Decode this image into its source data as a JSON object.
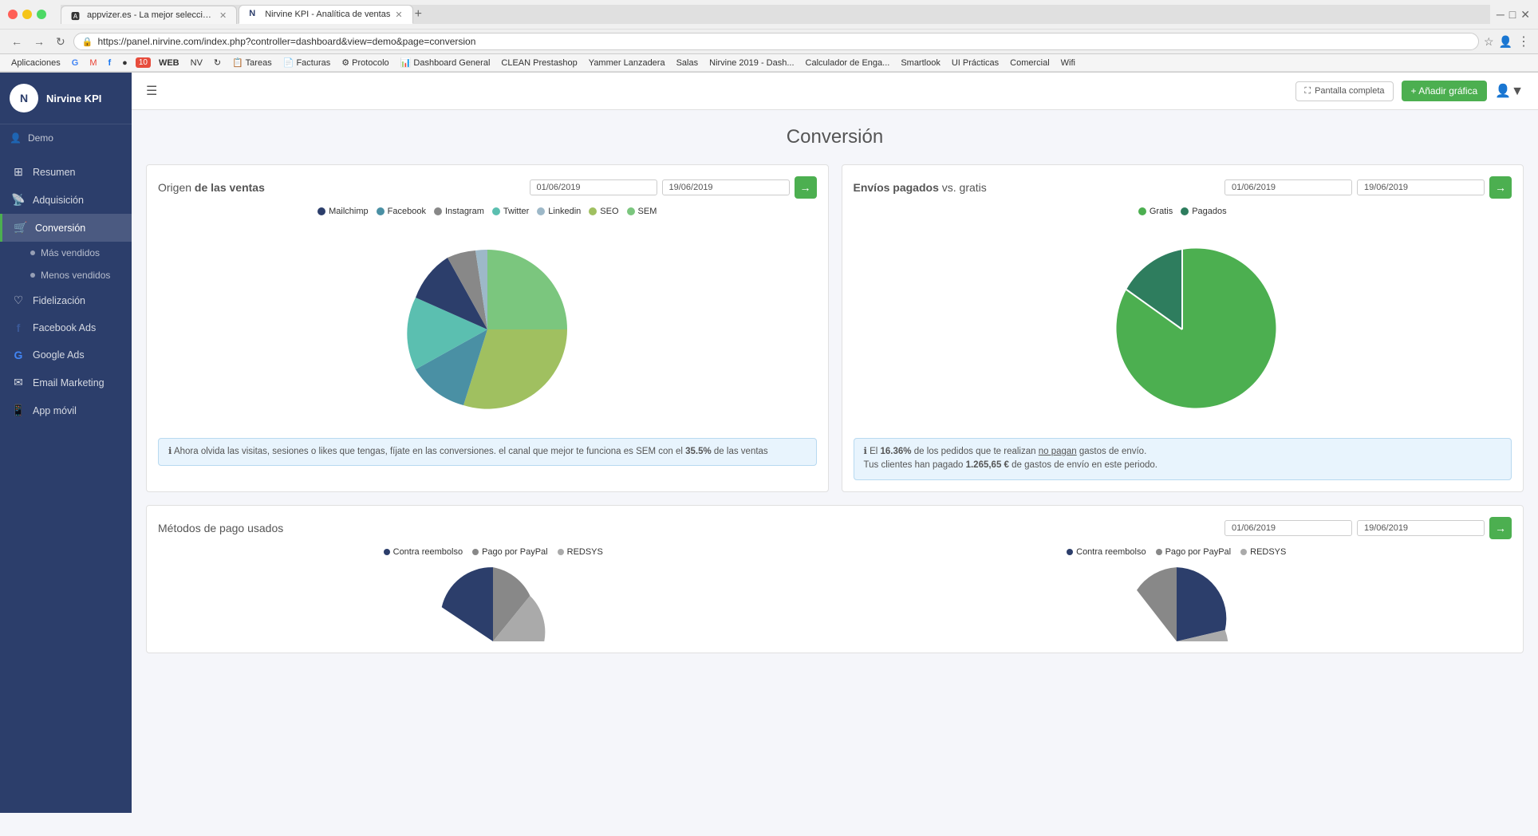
{
  "browser": {
    "tabs": [
      {
        "id": "tab1",
        "label": "appvizer.es - La mejor selección...",
        "favicon": "🅰",
        "active": false
      },
      {
        "id": "tab2",
        "label": "Nirvine KPI - Analítica de ventas",
        "favicon": "N",
        "active": true
      }
    ],
    "url": "https://panel.nirvine.com/index.php?controller=dashboard&view=demo&page=conversion",
    "bookmarks": [
      "Aplicaciones",
      "G",
      "M",
      "f",
      "●",
      "10",
      "WEB",
      "NV",
      "↻",
      "Tareas",
      "Facturas",
      "Protocolo",
      "Dashboard General",
      "CLEAN Prestashop",
      "Yammer Lanzadera",
      "Salas",
      "Nirvine 2019 - Dash...",
      "Calculador de Enga...",
      "Smartlook",
      "UI Prácticas",
      "Comercial",
      "Wifi"
    ]
  },
  "sidebar": {
    "logo_letter": "N",
    "app_name": "Nirvine KPI",
    "user": "Demo",
    "nav_items": [
      {
        "id": "resumen",
        "label": "Resumen",
        "icon": "⊞"
      },
      {
        "id": "adquisicion",
        "label": "Adquisición",
        "icon": "📡"
      },
      {
        "id": "conversion",
        "label": "Conversión",
        "icon": "🛒",
        "active": true
      },
      {
        "id": "mas-vendidos",
        "label": "Más vendidos",
        "icon": "•",
        "sub": true
      },
      {
        "id": "menos-vendidos",
        "label": "Menos vendidos",
        "icon": "•",
        "sub": true
      },
      {
        "id": "fidelizacion",
        "label": "Fidelización",
        "icon": "♡"
      },
      {
        "id": "facebook-ads",
        "label": "Facebook Ads",
        "icon": "f"
      },
      {
        "id": "google-ads",
        "label": "Google Ads",
        "icon": "G"
      },
      {
        "id": "email-marketing",
        "label": "Email Marketing",
        "icon": "✉"
      },
      {
        "id": "app-movil",
        "label": "App móvil",
        "icon": "📱"
      }
    ]
  },
  "header": {
    "fullscreen_label": "Pantalla completa",
    "add_chart_label": "+ Añadir gráfica"
  },
  "page": {
    "title": "Conversión"
  },
  "chart1": {
    "title_normal": "Origen",
    "title_bold": " de las ventas",
    "date_start": "01/06/2019",
    "date_end": "19/06/2019",
    "legend": [
      {
        "label": "Mailchimp",
        "color": "#2c3e6b"
      },
      {
        "label": "Facebook",
        "color": "#4a90a4"
      },
      {
        "label": "Instagram",
        "color": "#888"
      },
      {
        "label": "Twitter",
        "color": "#5bbfb0"
      },
      {
        "label": "Linkedin",
        "color": "#9db8c8"
      },
      {
        "label": "SEO",
        "color": "#a0c060"
      },
      {
        "label": "SEM",
        "color": "#7bc67e"
      }
    ],
    "info_text": "ℹ Ahora olvida las visitas, sesiones o likes que tengas, fíjate en las conversiones. el canal que mejor te funciona es SEM con el 35.5% de las ventas"
  },
  "chart2": {
    "title_normal": "Envíos pagados",
    "title_bold": " vs. gratis",
    "date_start": "01/06/2019",
    "date_end": "19/06/2019",
    "legend": [
      {
        "label": "Gratis",
        "color": "#4CAF50"
      },
      {
        "label": "Pagados",
        "color": "#2e7d5e"
      }
    ],
    "info_text": "ℹ El 16.36% de los pedidos que te realizan no pagan gastos de envío. Tus clientes han pagado 1.265,65 € de gastos de envío en este periodo."
  },
  "chart3": {
    "title": "Métodos de pago usados",
    "date_start": "01/06/2019",
    "date_end": "19/06/2019",
    "legend_left": [
      {
        "label": "Contra reembolso",
        "color": "#2c3e6b"
      },
      {
        "label": "Pago por PayPal",
        "color": "#888"
      },
      {
        "label": "REDSYS",
        "color": "#aaa"
      }
    ],
    "legend_right": [
      {
        "label": "Contra reembolso",
        "color": "#2c3e6b"
      },
      {
        "label": "Pago por PayPal",
        "color": "#888"
      },
      {
        "label": "REDSYS",
        "color": "#aaa"
      }
    ]
  }
}
